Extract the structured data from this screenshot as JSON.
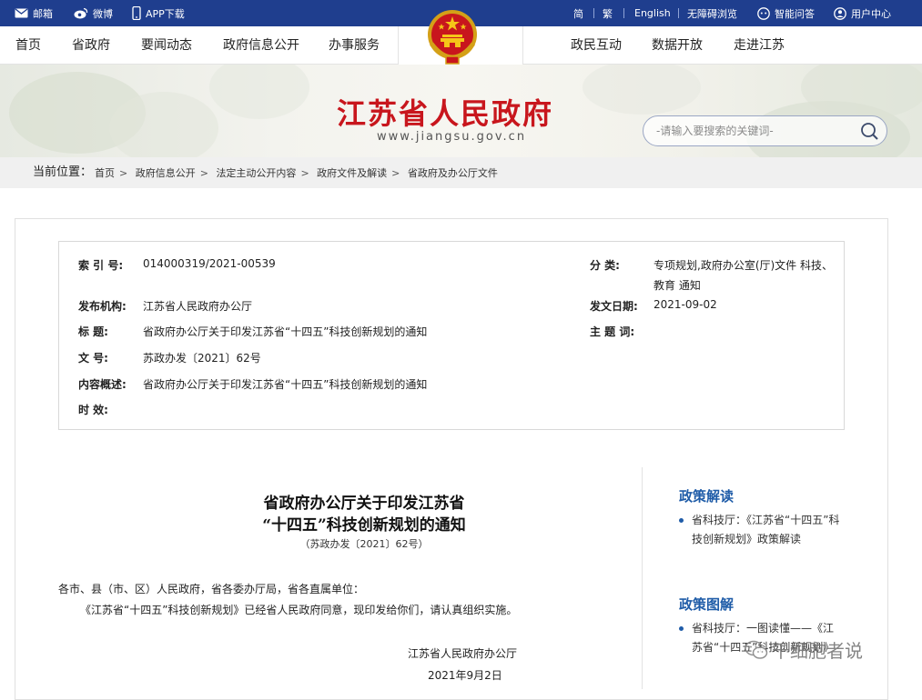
{
  "topbar": {
    "mail": "邮箱",
    "weibo": "微博",
    "app": "APP下载",
    "simplified": "简",
    "traditional": "繁",
    "english": "English",
    "accessible": "无障碍浏览",
    "qa": "智能问答",
    "user": "用户中心"
  },
  "nav": {
    "home": "首页",
    "province": "省政府",
    "news": "要闻动态",
    "info": "政府信息公开",
    "service": "办事服务",
    "interact": "政民互动",
    "data": "数据开放",
    "explore": "走进江苏"
  },
  "banner": {
    "title": "江苏省人民政府",
    "url": "www.jiangsu.gov.cn",
    "search_placeholder": "-请输入要搜索的关键词-"
  },
  "breadcrumb": {
    "label": "当前位置：",
    "items": [
      "首页",
      "政府信息公开",
      "法定主动公开内容",
      "政府文件及解读",
      "省政府及办公厅文件"
    ]
  },
  "meta": {
    "index_label": "索 引 号:",
    "index_value": "014000319/2021-00539",
    "category_label": "分    类:",
    "category_value_1": "专项规划,政府办公室(厅)文件 科技、",
    "category_value_2": "教育 通知",
    "publisher_label": "发布机构:",
    "publisher_value": "江苏省人民政府办公厅",
    "date_label": "发文日期:",
    "date_value": "2021-09-02",
    "title_label": "标      题:",
    "title_value": "省政府办公厅关于印发江苏省“十四五”科技创新规划的通知",
    "subject_label": "主 题 词:",
    "subject_value": "",
    "docno_label": "文      号:",
    "docno_value": "苏政办发〔2021〕62号",
    "summary_label": "内容概述:",
    "summary_value": "省政府办公厅关于印发江苏省“十四五”科技创新规划的通知",
    "validity_label": "时      效:",
    "validity_value": ""
  },
  "doc": {
    "title_line1": "省政府办公厅关于印发江苏省",
    "title_line2": "“十四五”科技创新规划的通知",
    "number": "（苏政办发〔2021〕62号）",
    "greeting": "各市、县（市、区）人民政府，省各委办厅局，省各直属单位：",
    "body": "《江苏省“十四五”科技创新规划》已经省人民政府同意，现印发给你们，请认真组织实施。",
    "signature": "江苏省人民政府办公厅",
    "sign_date": "2021年9月2日"
  },
  "side": {
    "interpret_title": "政策解读",
    "interpret_item": "省科技厅：《江苏省“十四五”科技创新规划》政策解读",
    "graphic_title": "政策图解",
    "graphic_item": "省科技厅：一图读懂——《江苏省“十四五”科技创新规划》"
  },
  "watermark": "千细胞者说",
  "colors": {
    "topbar": "#1f3e8e",
    "title_red": "#c8161d",
    "side_blue": "#1f5ca8"
  }
}
